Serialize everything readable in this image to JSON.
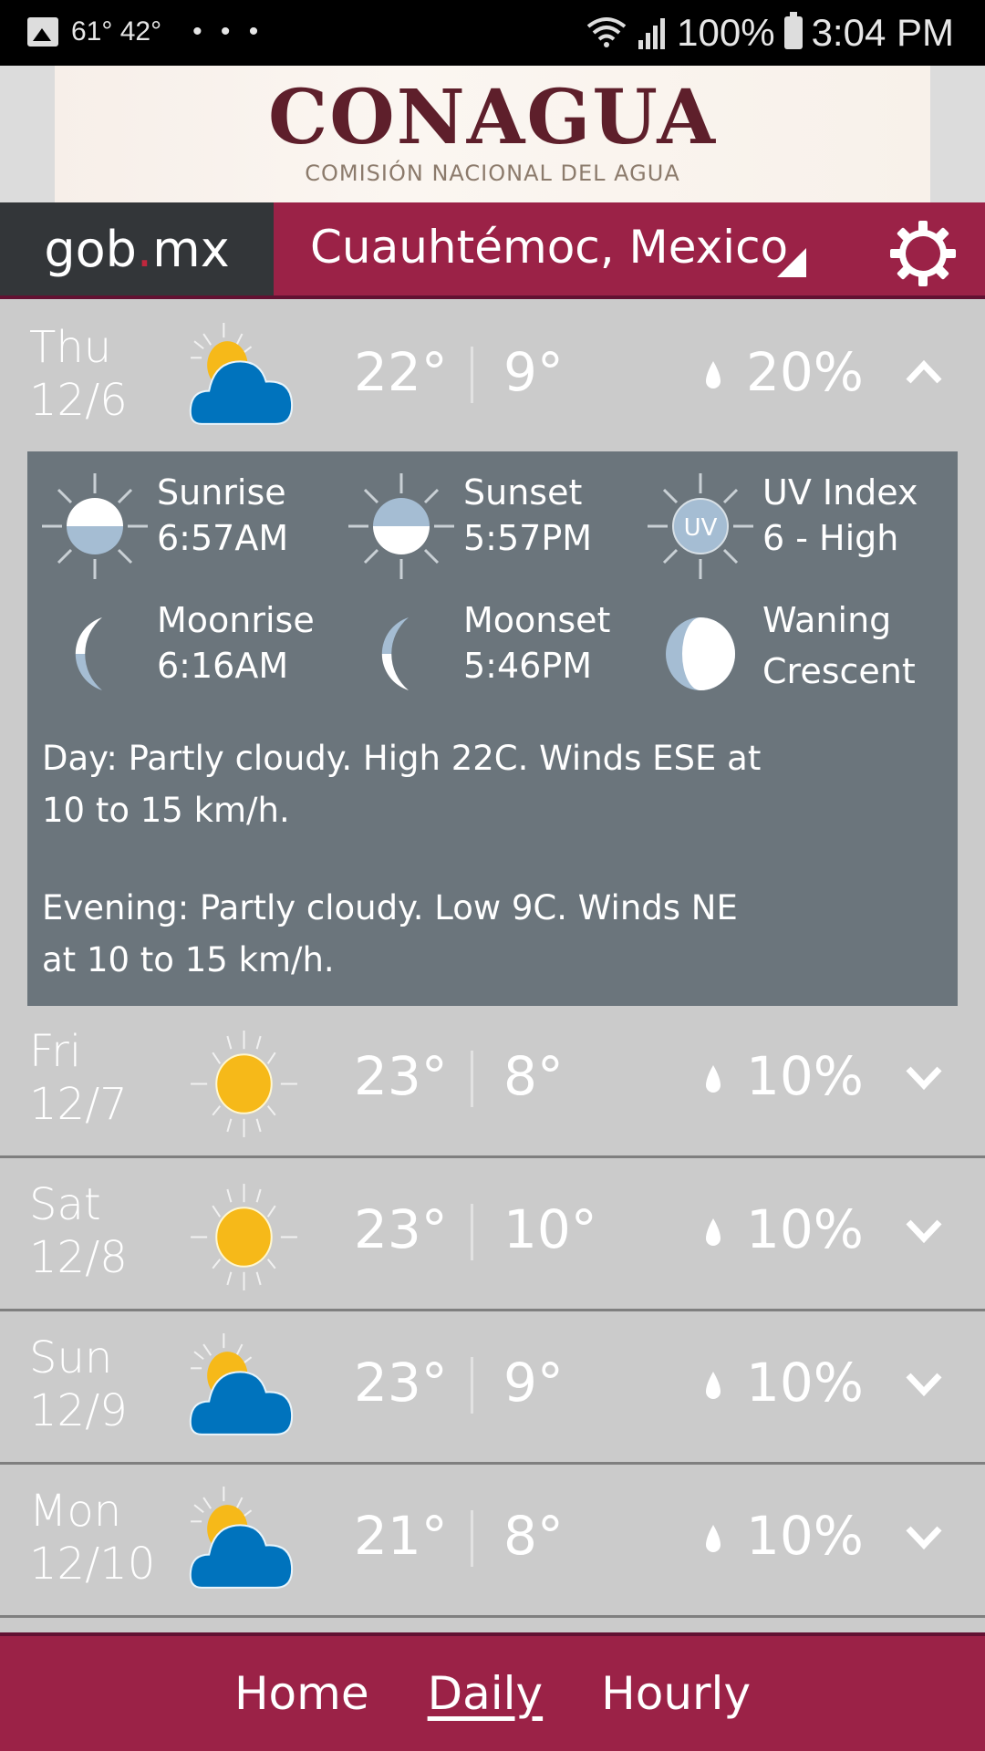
{
  "status_bar": {
    "temps": "61° 42°",
    "more": "• • •",
    "battery": "100%",
    "time": "3:04 PM"
  },
  "banner": {
    "logo_title": "CONAGUA",
    "logo_subtitle": "COMISIÓN NACIONAL DEL AGUA"
  },
  "header": {
    "brand_pre": "gob",
    "brand_dot": ".",
    "brand_post": "mx",
    "location": "Cuauhtémoc, Mexico",
    "settings_icon": "gear-icon"
  },
  "days": [
    {
      "day": "Thu",
      "date": "12/6",
      "icon": "partly-cloudy",
      "high": "22°",
      "low": "9°",
      "precip": "20%",
      "expanded": true
    },
    {
      "day": "Fri",
      "date": "12/7",
      "icon": "sunny",
      "high": "23°",
      "low": "8°",
      "precip": "10%",
      "expanded": false
    },
    {
      "day": "Sat",
      "date": "12/8",
      "icon": "sunny",
      "high": "23°",
      "low": "10°",
      "precip": "10%",
      "expanded": false
    },
    {
      "day": "Sun",
      "date": "12/9",
      "icon": "partly-cloudy",
      "high": "23°",
      "low": "9°",
      "precip": "10%",
      "expanded": false
    },
    {
      "day": "Mon",
      "date": "12/10",
      "icon": "partly-cloudy",
      "high": "21°",
      "low": "8°",
      "precip": "10%",
      "expanded": false
    }
  ],
  "details": {
    "sunrise": {
      "label": "Sunrise",
      "value": "6:57AM"
    },
    "sunset": {
      "label": "Sunset",
      "value": "5:57PM"
    },
    "uv": {
      "label": "UV Index",
      "value": "6 - High",
      "badge": "UV"
    },
    "moonrise": {
      "label": "Moonrise",
      "value": "6:16AM"
    },
    "moonset": {
      "label": "Moonset",
      "value": "5:46PM"
    },
    "moon_phase": {
      "line1": "Waning",
      "line2": "Crescent"
    },
    "day_text_1": "Day: Partly cloudy. High 22C. Winds ESE at",
    "day_text_2": "10 to 15 km/h.",
    "evening_text_1": "Evening: Partly cloudy. Low 9C. Winds NE",
    "evening_text_2": "at 10 to 15 km/h."
  },
  "nav": {
    "home": "Home",
    "daily": "Daily",
    "hourly": "Hourly",
    "active": "Daily"
  },
  "colors": {
    "brand": "#9b2247",
    "brand_dark": "#621132",
    "gob_bg": "#333639",
    "details_bg": "#6b757c",
    "row_bg": "#cbcbcb",
    "sun": "#f6b919",
    "cloud": "#0073bd",
    "icon_light": "#a5bdd3"
  }
}
